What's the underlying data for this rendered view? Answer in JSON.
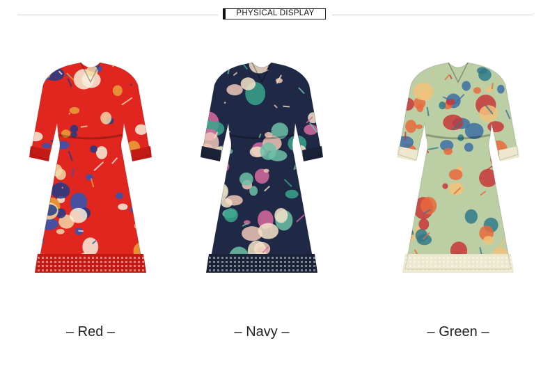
{
  "header": {
    "title": "PHYSICAL DISPLAY"
  },
  "variants": [
    {
      "caption": "– Red –",
      "color_name": "Red",
      "base_color": "#e0261f",
      "hem_color": "#c41a16",
      "flower_colors": [
        "#f3d7a6",
        "#2d57b5",
        "#f7f0dc",
        "#e8a23a",
        "#1f3b8a"
      ]
    },
    {
      "caption": "– Navy –",
      "color_name": "Navy",
      "base_color": "#1f2844",
      "hem_color": "#1a2238",
      "flower_colors": [
        "#f0c7b9",
        "#3aa48c",
        "#d86aa0",
        "#f5e3c8",
        "#6fc1a7"
      ]
    },
    {
      "caption": "– Green –",
      "color_name": "Green",
      "base_color": "#bccfa4",
      "hem_color": "#ece7cd",
      "flower_colors": [
        "#e86a3c",
        "#2f7a8c",
        "#f1c27a",
        "#c9363a",
        "#3d6fa3"
      ]
    }
  ]
}
